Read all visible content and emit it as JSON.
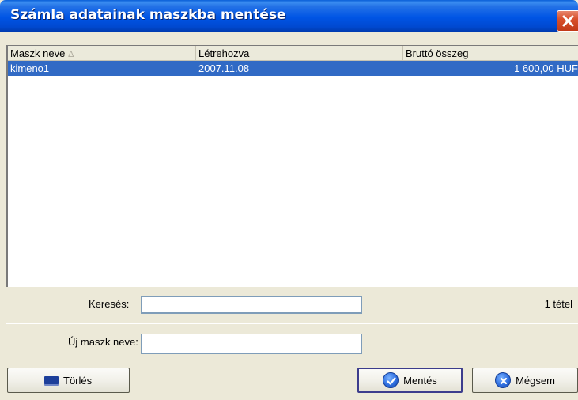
{
  "window": {
    "title": "Számla adatainak maszkba mentése"
  },
  "list": {
    "columns": [
      {
        "label": "Maszk neve",
        "sort_indicator": "∆"
      },
      {
        "label": "Létrehozva"
      },
      {
        "label": "Bruttó összeg"
      }
    ],
    "rows": [
      {
        "name": "kimeno1",
        "created": "2007.11.08",
        "gross": "1 600,00 HUF",
        "selected": true
      }
    ]
  },
  "search": {
    "label": "Keresés:",
    "value": ""
  },
  "count": "1 tétel",
  "new_mask": {
    "label": "Új maszk neve:",
    "value": ""
  },
  "buttons": {
    "delete": "Törlés",
    "save": "Mentés",
    "cancel": "Mégsem"
  },
  "colors": {
    "title_bar": "#0055e5",
    "selection": "#316ac5",
    "dialog_bg": "#ece9d8",
    "close_button": "#d8502c"
  },
  "icons": {
    "close": "close-icon",
    "delete": "keyboard-icon",
    "save": "checkmark-icon",
    "cancel": "x-circle-icon"
  }
}
